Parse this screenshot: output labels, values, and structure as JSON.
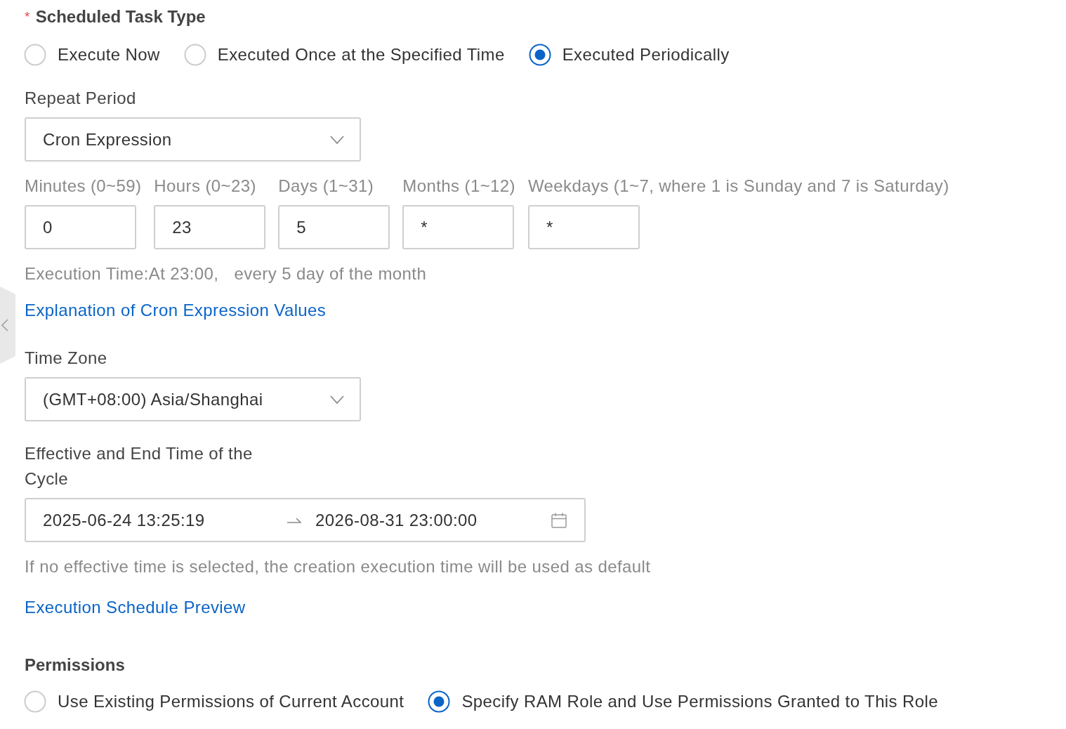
{
  "task_type": {
    "required_mark": "*",
    "label": "Scheduled Task Type",
    "options": [
      {
        "label": "Execute Now",
        "selected": false
      },
      {
        "label": "Executed Once at the Specified Time",
        "selected": false
      },
      {
        "label": "Executed Periodically",
        "selected": true
      }
    ]
  },
  "repeat_period": {
    "label": "Repeat Period",
    "value": "Cron Expression"
  },
  "cron_fields": [
    {
      "label": "Minutes (0~59)",
      "value": "0"
    },
    {
      "label": "Hours (0~23)",
      "value": "23"
    },
    {
      "label": "Days (1~31)",
      "value": "5"
    },
    {
      "label": "Months (1~12)",
      "value": "*"
    },
    {
      "label": "Weekdays (1~7, where 1 is Sunday and 7 is Saturday)",
      "value": "*"
    }
  ],
  "execution_time": [
    "Execution Time:At 23:00,",
    "every 5 day of the month"
  ],
  "cron_help_link": "Explanation of Cron Expression Values",
  "time_zone": {
    "label": "Time Zone",
    "value": "(GMT+08:00) Asia/Shanghai"
  },
  "cycle": {
    "label": "Effective and End Time of the Cycle",
    "start": "2025-06-24 13:25:19",
    "end": "2026-08-31 23:00:00",
    "hint": "If no effective time is selected, the creation execution time will be used as default"
  },
  "preview_link": "Execution Schedule Preview",
  "permissions": {
    "label": "Permissions",
    "options": [
      {
        "label": "Use Existing Permissions of Current Account",
        "selected": false
      },
      {
        "label": "Specify RAM Role and Use Permissions Granted to This Role",
        "selected": true
      }
    ]
  }
}
